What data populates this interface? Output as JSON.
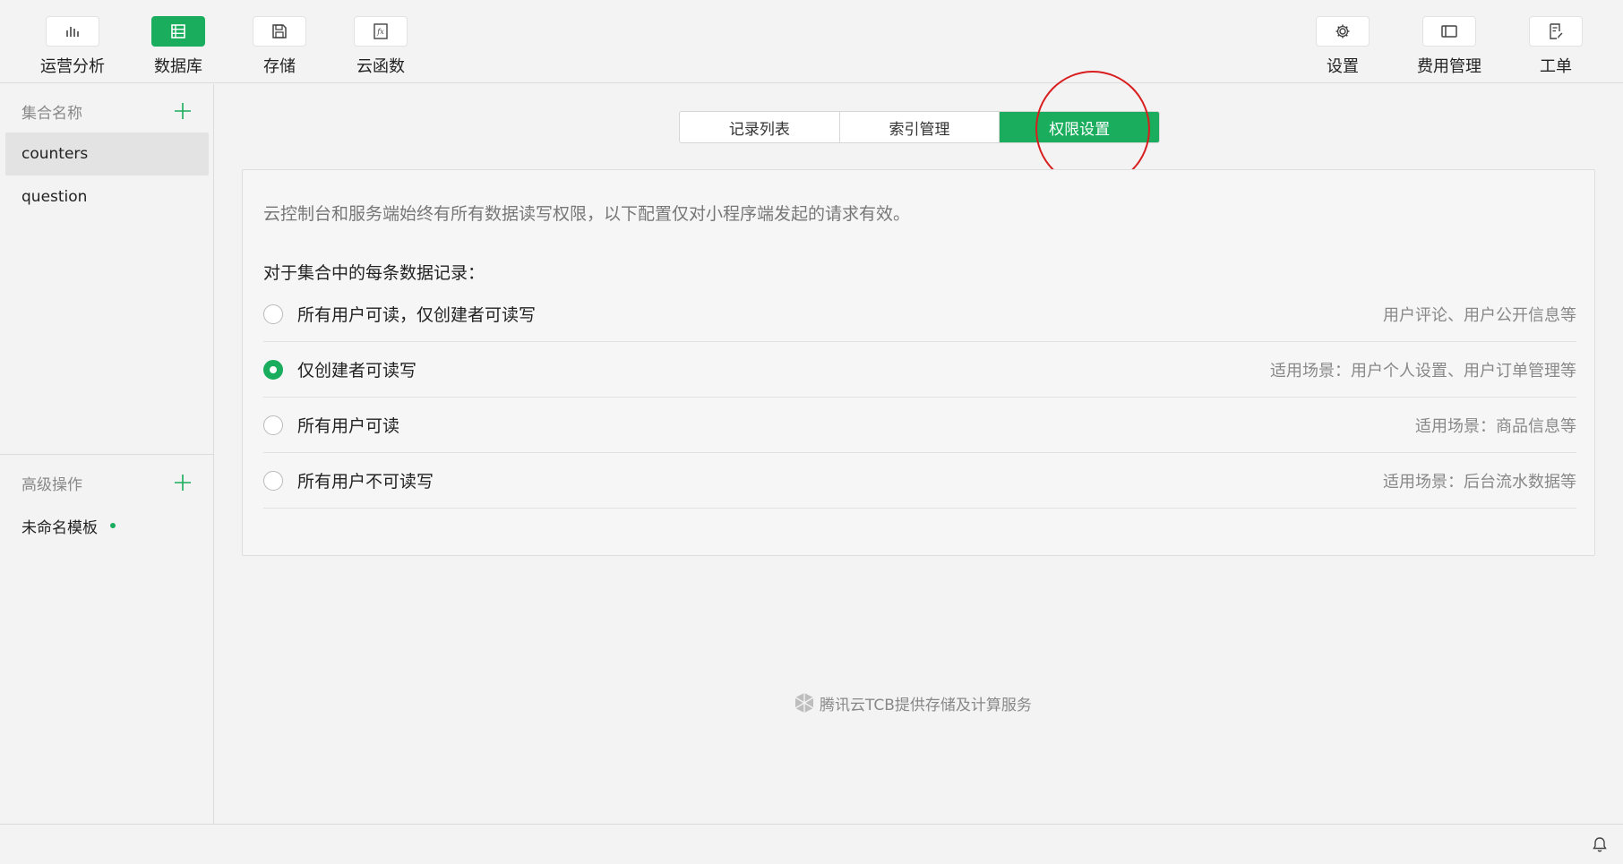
{
  "toolbar": {
    "left": [
      {
        "label": "运营分析",
        "icon": "bar-chart-icon",
        "active": false
      },
      {
        "label": "数据库",
        "icon": "database-icon",
        "active": true
      },
      {
        "label": "存储",
        "icon": "storage-icon",
        "active": false
      },
      {
        "label": "云函数",
        "icon": "cloud-function-icon",
        "active": false
      }
    ],
    "right": [
      {
        "label": "设置",
        "icon": "gear-icon"
      },
      {
        "label": "费用管理",
        "icon": "billing-icon"
      },
      {
        "label": "工单",
        "icon": "ticket-icon"
      }
    ]
  },
  "sidebar": {
    "collections_header": "集合名称",
    "collections": [
      {
        "name": "counters",
        "selected": true
      },
      {
        "name": "question",
        "selected": false
      }
    ],
    "advanced_header": "高级操作",
    "templates": [
      {
        "name": "未命名模板",
        "unsaved": true
      }
    ]
  },
  "tabs": [
    {
      "label": "记录列表",
      "active": false
    },
    {
      "label": "索引管理",
      "active": false
    },
    {
      "label": "权限设置",
      "active": true
    }
  ],
  "permissions": {
    "notice": "云控制台和服务端始终有所有数据读写权限，以下配置仅对小程序端发起的请求有效。",
    "subheading": "对于集合中的每条数据记录：",
    "options": [
      {
        "label": "所有用户可读，仅创建者可读写",
        "hint": "用户评论、用户公开信息等",
        "checked": false
      },
      {
        "label": "仅创建者可读写",
        "hint": "适用场景：用户个人设置、用户订单管理等",
        "checked": true
      },
      {
        "label": "所有用户可读",
        "hint": "适用场景：商品信息等",
        "checked": false
      },
      {
        "label": "所有用户不可读写",
        "hint": "适用场景：后台流水数据等",
        "checked": false
      }
    ]
  },
  "footer": {
    "text": "腾讯云TCB提供存储及计算服务",
    "icon": "tencent-cloud-logo-icon"
  },
  "statusbar": {
    "icon": "bell-icon"
  },
  "colors": {
    "accent": "#1aad5d",
    "highlight": "#d81e1e"
  }
}
